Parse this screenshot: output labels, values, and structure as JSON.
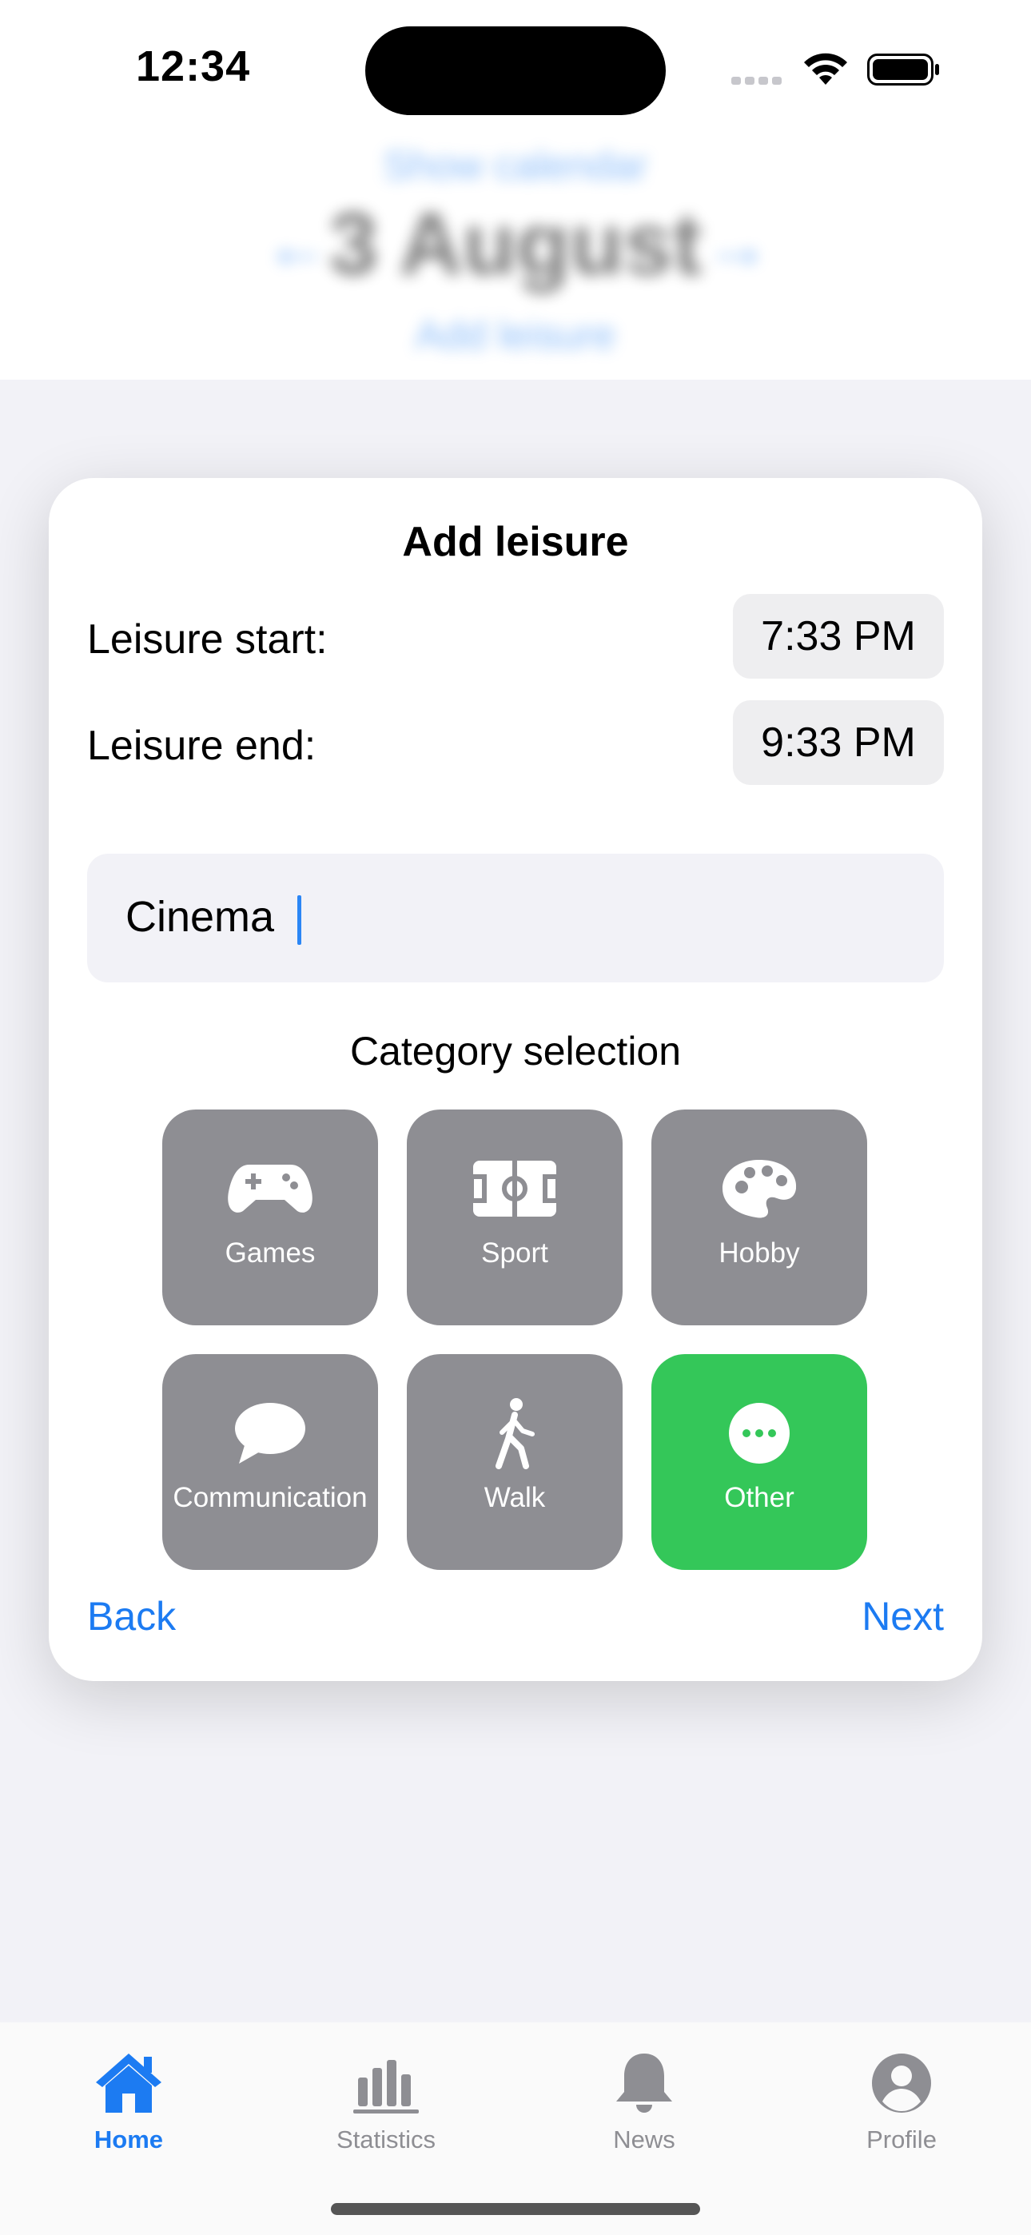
{
  "status_bar": {
    "time": "12:34"
  },
  "background": {
    "show_calendar": "Show calendar",
    "date": "3 August",
    "prev_arrow": "←",
    "next_arrow": "→",
    "add_leisure": "Add leisure"
  },
  "modal": {
    "title": "Add leisure",
    "start_label": "Leisure start:",
    "start_time": "7:33 PM",
    "end_label": "Leisure end:",
    "end_time": "9:33 PM",
    "name_value": "Cinema",
    "category_heading": "Category selection",
    "categories": [
      {
        "label": "Games",
        "icon": "gamecontroller-icon",
        "selected": false
      },
      {
        "label": "Sport",
        "icon": "sportscourt-icon",
        "selected": false
      },
      {
        "label": "Hobby",
        "icon": "paintpalette-icon",
        "selected": false
      },
      {
        "label": "Communication",
        "icon": "speech-bubble-icon",
        "selected": false
      },
      {
        "label": "Walk",
        "icon": "figure-walk-icon",
        "selected": false
      },
      {
        "label": "Other",
        "icon": "ellipsis-circle-icon",
        "selected": true
      }
    ],
    "back_label": "Back",
    "next_label": "Next"
  },
  "tab_bar": {
    "tabs": [
      {
        "label": "Home",
        "icon": "house-icon",
        "active": true
      },
      {
        "label": "Statistics",
        "icon": "chart-bar-icon",
        "active": false
      },
      {
        "label": "News",
        "icon": "bell-icon",
        "active": false
      },
      {
        "label": "Profile",
        "icon": "person-circle-icon",
        "active": false
      }
    ]
  },
  "colors": {
    "accent": "#1c7bf2",
    "tile_gray": "#8e8e93",
    "tile_selected": "#34c759",
    "background": "#f2f2f7"
  }
}
